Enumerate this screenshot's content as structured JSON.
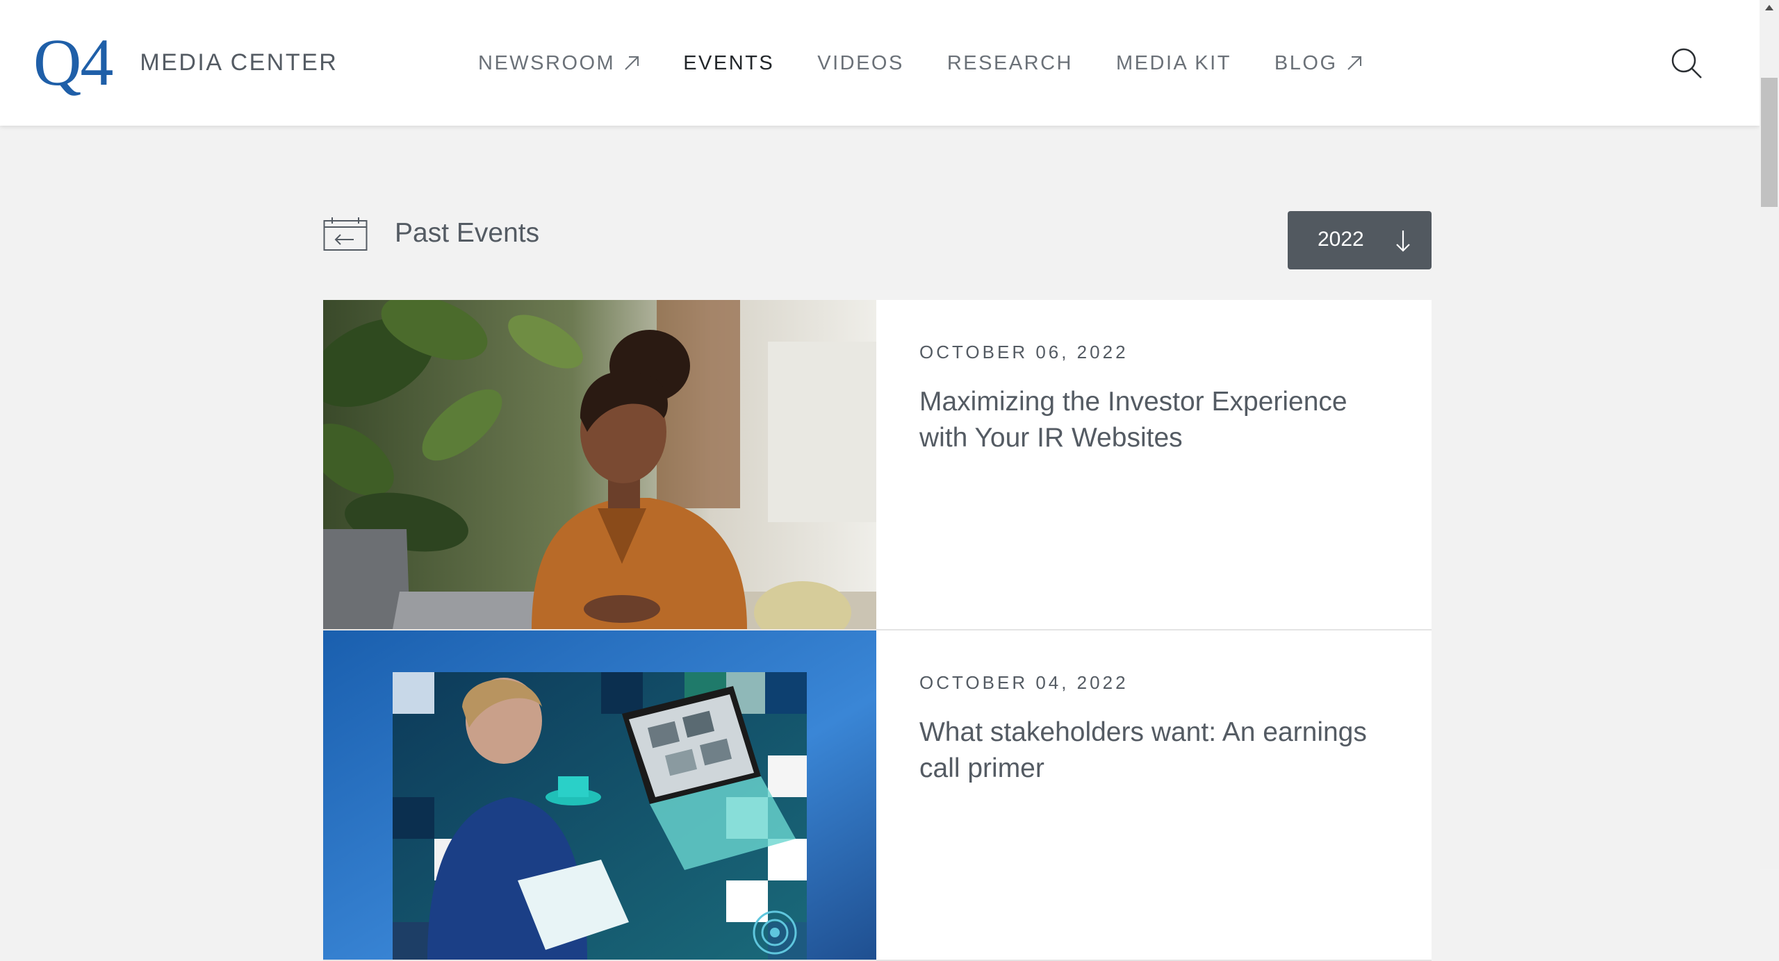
{
  "header": {
    "logo_mark": "Q4",
    "logo_text": "MEDIA CENTER",
    "nav": [
      {
        "label": "NEWSROOM",
        "external": true,
        "active": false
      },
      {
        "label": "EVENTS",
        "external": false,
        "active": true
      },
      {
        "label": "VIDEOS",
        "external": false,
        "active": false
      },
      {
        "label": "RESEARCH",
        "external": false,
        "active": false
      },
      {
        "label": "MEDIA KIT",
        "external": false,
        "active": false
      },
      {
        "label": "BLOG",
        "external": true,
        "active": false
      }
    ],
    "search_icon": "search-icon"
  },
  "section": {
    "icon": "calendar-back-icon",
    "title": "Past Events",
    "year_select": {
      "value": "2022",
      "icon": "arrow-down-icon"
    }
  },
  "events": [
    {
      "date": "OCTOBER 06, 2022",
      "title": "Maximizing the Investor Experience with Your IR Websites",
      "image": "woman-using-laptop-photo"
    },
    {
      "date": "OCTOBER 04, 2022",
      "title": "What stakeholders want: An earnings call primer",
      "image": "video-call-collage-photo"
    }
  ],
  "colors": {
    "brand_blue": "#1f5fa8",
    "text": "#545b63",
    "active_nav": "#22262a",
    "select_bg": "#525960",
    "page_bg": "#f2f2f2"
  }
}
